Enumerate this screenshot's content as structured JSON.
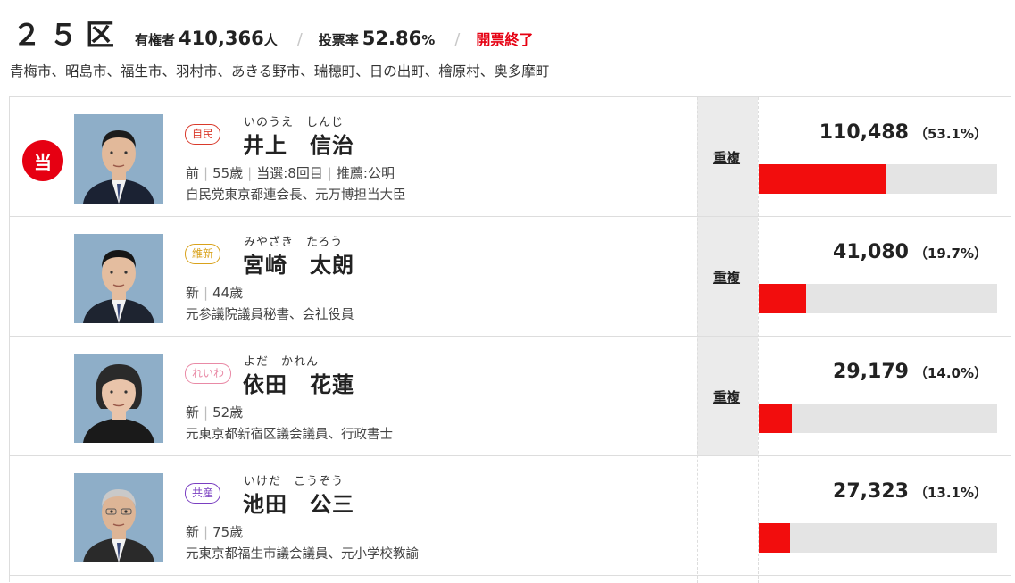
{
  "header": {
    "district": "２５区",
    "voters_label": "有権者",
    "voters_value": "410,366",
    "voters_unit": "人",
    "turnout_label": "投票率",
    "turnout_value": "52.86",
    "turnout_unit": "%",
    "separator": "/",
    "status": "開票終了"
  },
  "areas": "青梅市、昭島市、福生市、羽村市、あきる野市、瑞穂町、日の出町、檜原村、奥多摩町",
  "colors": {
    "accent": "#e60012",
    "bar_fill": "#f20d0d",
    "bar_track": "#e4e4e4"
  },
  "candidates": [
    {
      "winner": "当",
      "party": "自民",
      "party_color": "#d93a2b",
      "kana": "いのうえ　しんじ",
      "name": "井上　信治",
      "status": "前",
      "age": "55歳",
      "elected": "当選:8回目",
      "endorsement": "推薦:公明",
      "career": "自民党東京都連会長、元万博担当大臣",
      "duplicate": "重複",
      "votes": "110,488",
      "percent": "（53.1%）",
      "share": 0.531
    },
    {
      "winner": "",
      "party": "維新",
      "party_color": "#d9a21b",
      "kana": "みやざき　たろう",
      "name": "宮崎　太朗",
      "status": "新",
      "age": "44歳",
      "elected": "",
      "endorsement": "",
      "career": "元参議院議員秘書、会社役員",
      "duplicate": "重複",
      "votes": "41,080",
      "percent": "（19.7%）",
      "share": 0.197
    },
    {
      "winner": "",
      "party": "れいわ",
      "party_color": "#e98aa6",
      "kana": "よだ　かれん",
      "name": "依田　花蓮",
      "status": "新",
      "age": "52歳",
      "elected": "",
      "endorsement": "",
      "career": "元東京都新宿区議会議員、行政書士",
      "duplicate": "重複",
      "votes": "29,179",
      "percent": "（14.0%）",
      "share": 0.14
    },
    {
      "winner": "",
      "party": "共産",
      "party_color": "#7a3fc1",
      "kana": "いけだ　こうぞう",
      "name": "池田　公三",
      "status": "新",
      "age": "75歳",
      "elected": "",
      "endorsement": "",
      "career": "元東京都福生市議会議員、元小学校教諭",
      "duplicate": "",
      "votes": "27,323",
      "percent": "（13.1%）",
      "share": 0.131
    }
  ]
}
